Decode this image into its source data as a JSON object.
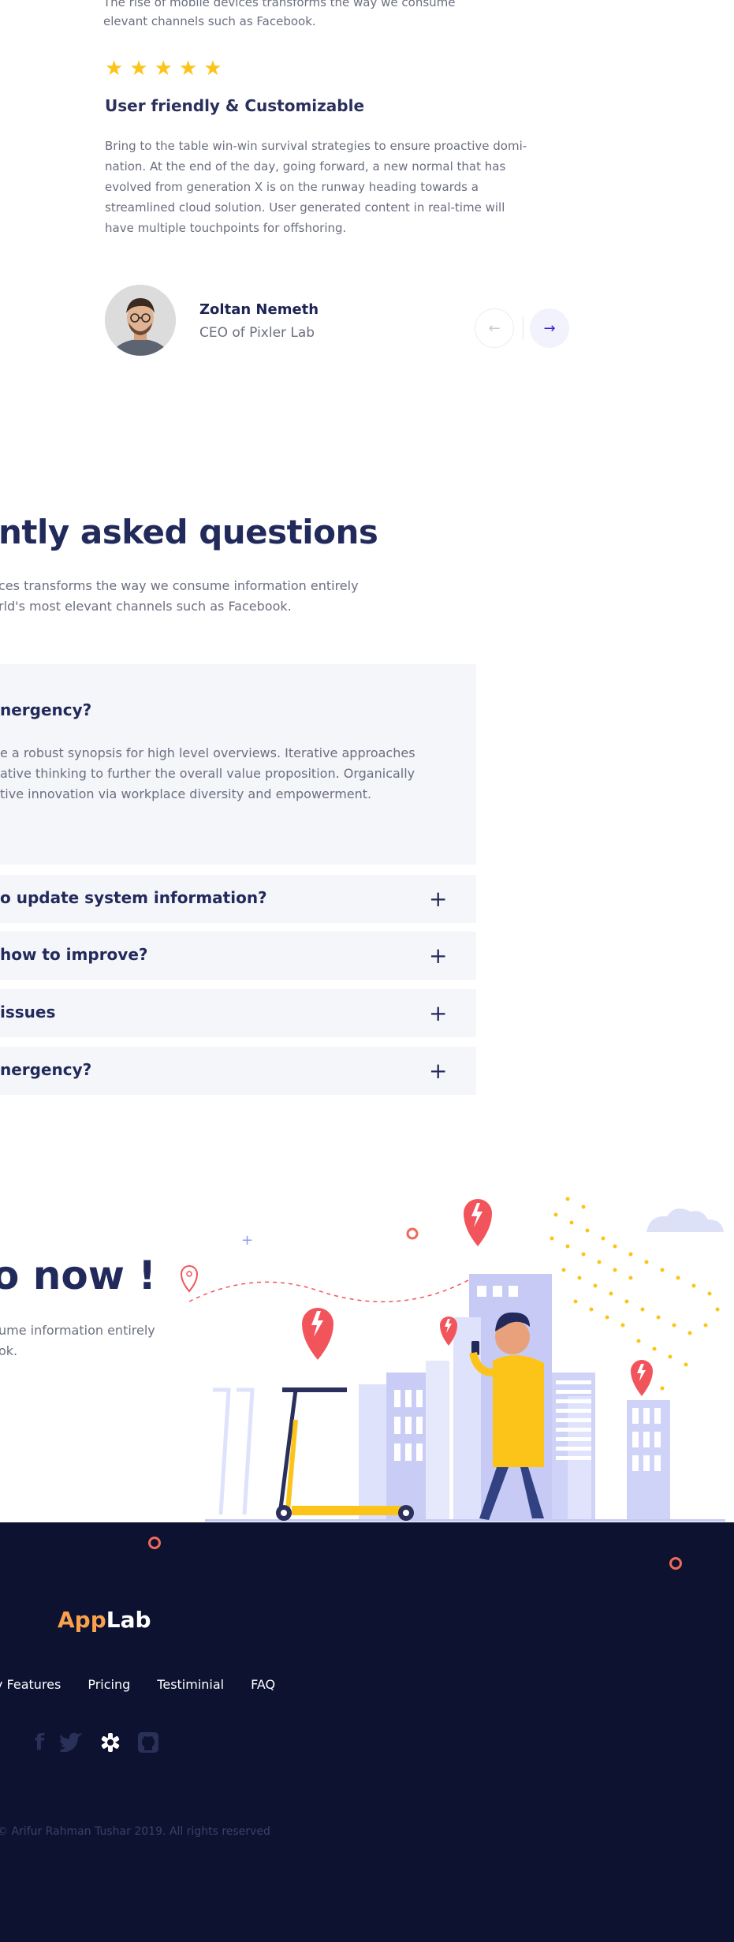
{
  "testimonial": {
    "intro_line1": "The rise of mobile devices transforms the way we consume",
    "intro_line2": "elevant channels such as Facebook.",
    "stars": [
      "★",
      "★",
      "★",
      "★",
      "★"
    ],
    "rating": 5,
    "title": "User friendly & Customizable",
    "body": [
      "Bring to the table win-win survival strategies to ensure proactive domi-",
      "nation. At the end of the day, going forward, a new normal that has",
      "evolved from generation X is on the runway heading towards a",
      "streamlined cloud solution. User generated content in real-time will",
      "have multiple touchpoints for offshoring."
    ],
    "author_name": "Zoltan Nemeth",
    "author_role": "CEO of Pixler Lab",
    "prev_icon": "←",
    "next_icon": "→"
  },
  "faq": {
    "heading": "ntly asked questions",
    "sub_line1": "ces transforms the way we consume information entirely",
    "sub_line2": "rld's most elevant channels such as Facebook.",
    "open_item": {
      "question": "nergency?",
      "answer": [
        "e a robust synopsis for high level overviews. Iterative approaches",
        "ative thinking to further the overall value proposition. Organically",
        "tive innovation via workplace diversity and empowerment."
      ]
    },
    "items": [
      {
        "question": "o update system information?",
        "icon": "+"
      },
      {
        "question": " how to improve?",
        "icon": "+"
      },
      {
        "question": " issues",
        "icon": "+"
      },
      {
        "question": "nergency?",
        "icon": "+"
      }
    ]
  },
  "cta": {
    "heading": "o now !",
    "sub_line1": "ume information entirely",
    "sub_line2": "ok."
  },
  "footer": {
    "logo_a": "App",
    "logo_b": "Lab",
    "nav": [
      "y Features",
      "Pricing",
      "Testiminial",
      "FAQ"
    ],
    "social": [
      {
        "name": "facebook-icon",
        "glyph": "f"
      },
      {
        "name": "twitter-icon",
        "glyph": "🐦"
      },
      {
        "name": "dribbble-icon",
        "glyph": "✲"
      },
      {
        "name": "github-icon",
        "glyph": "◘"
      }
    ],
    "copyright": "© Arifur Rahman Tushar 2019. All rights reserved"
  },
  "colors": {
    "star": "#fcc419",
    "accent": "#3c1fe3",
    "footer_bg": "#0c1230",
    "logo_orange": "#f99f4e",
    "pin_red": "#f2545b",
    "faq_bg": "#f5f6fa"
  }
}
